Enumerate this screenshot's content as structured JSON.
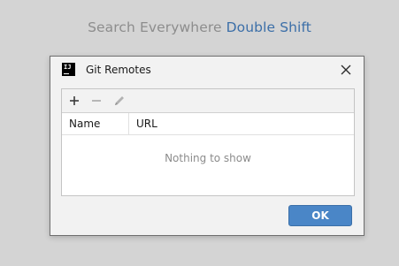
{
  "background_hint": {
    "text": "Search Everywhere",
    "shortcut": "Double Shift"
  },
  "dialog": {
    "app_icon_text": "IJ",
    "title": "Git Remotes",
    "toolbar": {
      "add_icon": "plus-icon",
      "remove_icon": "minus-icon",
      "edit_icon": "pencil-icon"
    },
    "table": {
      "columns": [
        "Name",
        "URL"
      ],
      "empty_text": "Nothing to show"
    },
    "ok_label": "OK"
  },
  "colors": {
    "accent": "#4a86c7",
    "shortcut": "#3c6fa8",
    "background": "#d4d4d4",
    "dialog_bg": "#f2f2f2"
  }
}
